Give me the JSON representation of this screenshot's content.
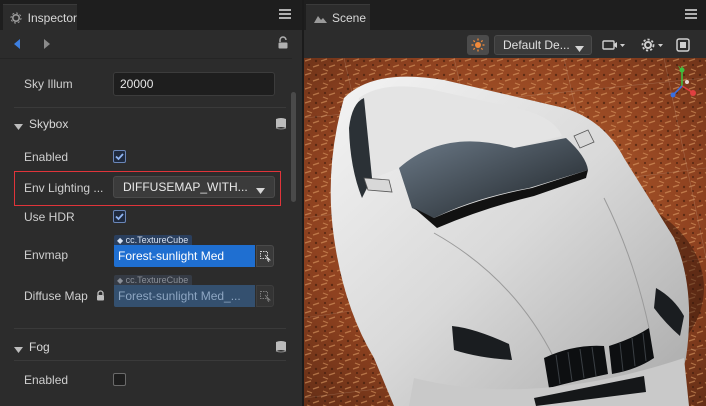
{
  "inspector": {
    "tab_title": "Inspector",
    "sky_illum": {
      "label": "Sky Illum",
      "value": "20000"
    },
    "skybox": {
      "title": "Skybox",
      "enabled_label": "Enabled",
      "enabled": true,
      "env_lighting": {
        "label": "Env Lighting ...",
        "value": "DIFFUSEMAP_WITH..."
      },
      "use_hdr_label": "Use HDR",
      "use_hdr": true,
      "envmap": {
        "label": "Envmap",
        "type_tag": "cc.TextureCube",
        "value": "Forest-sunlight Med"
      },
      "diffuse_map": {
        "label": "Diffuse Map",
        "type_tag": "cc.TextureCube",
        "value": "Forest-sunlight Med_..."
      }
    },
    "fog": {
      "title": "Fog",
      "enabled_label": "Enabled",
      "enabled": false
    }
  },
  "scene": {
    "tab_title": "Scene",
    "camera_dropdown": "Default De...",
    "gizmo_axis_label": "Y"
  },
  "colors": {
    "accent_blue": "#1f6fd1",
    "highlight_red": "#e0343a",
    "panel_bg": "#2c2c2c"
  }
}
